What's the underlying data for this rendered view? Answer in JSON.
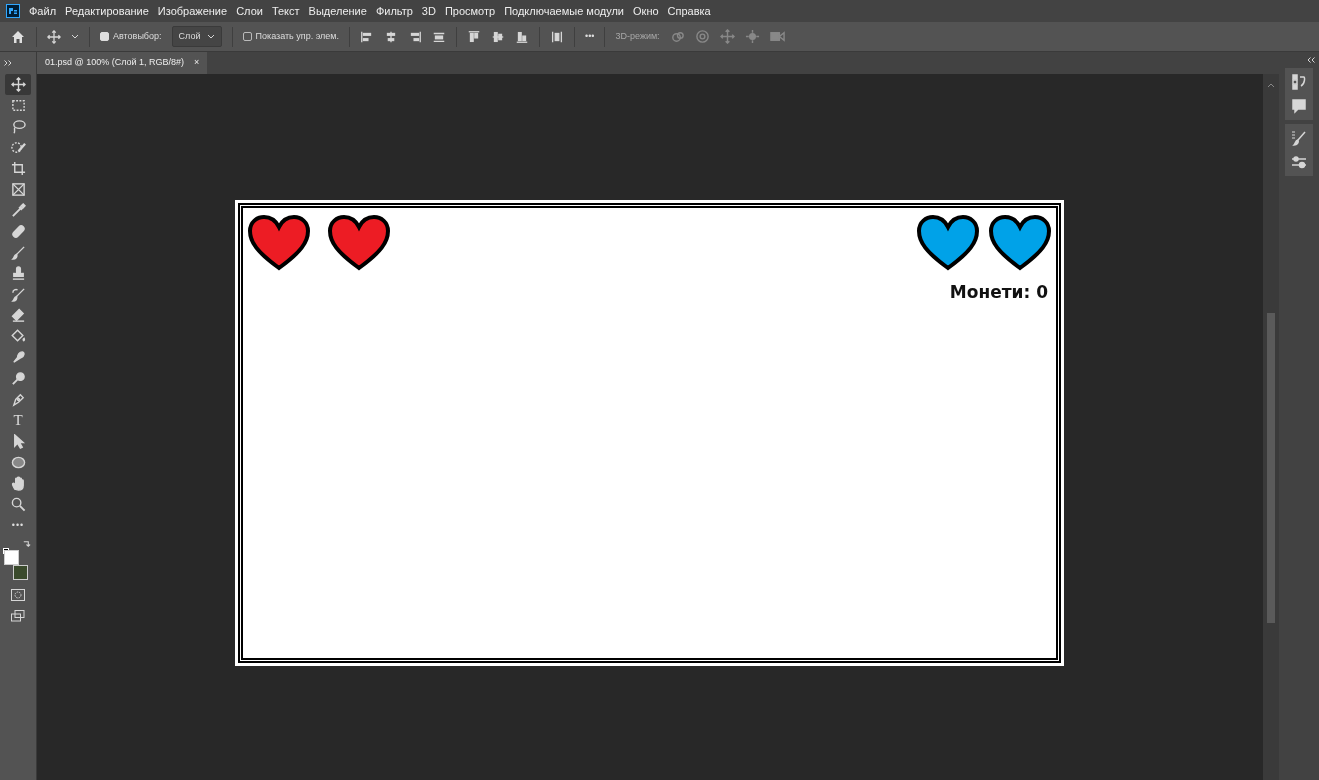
{
  "menu": {
    "items": [
      "Файл",
      "Редактирование",
      "Изображение",
      "Слои",
      "Текст",
      "Выделение",
      "Фильтр",
      "3D",
      "Просмотр",
      "Подключаемые модули",
      "Окно",
      "Справка"
    ]
  },
  "options_bar": {
    "autoselect": {
      "label": "Автовыбор:",
      "checked": true
    },
    "layer_dropdown": {
      "value": "Слой"
    },
    "show_transform": {
      "label": "Показать упр. элем.",
      "checked": false
    },
    "more_glyph": "•••",
    "mode_3d": {
      "label": "3D-режим:",
      "disabled": true
    }
  },
  "document_tab": {
    "title": "01.psd @ 100% (Слой 1, RGB/8#)",
    "close_glyph": "×",
    "selected": true
  },
  "tools": [
    {
      "kind": "move",
      "selected": true
    },
    {
      "kind": "marquee",
      "selected": false
    },
    {
      "kind": "lasso",
      "selected": false
    },
    {
      "kind": "quick-select",
      "selected": false
    },
    {
      "kind": "crop",
      "selected": false
    },
    {
      "kind": "frame",
      "selected": false
    },
    {
      "kind": "eyedropper",
      "selected": false
    },
    {
      "kind": "healing",
      "selected": false
    },
    {
      "kind": "brush",
      "selected": false
    },
    {
      "kind": "stamp",
      "selected": false
    },
    {
      "kind": "history-brush",
      "selected": false
    },
    {
      "kind": "eraser",
      "selected": false
    },
    {
      "kind": "bucket",
      "selected": false
    },
    {
      "kind": "smudge",
      "selected": false
    },
    {
      "kind": "dodge",
      "selected": false
    },
    {
      "kind": "pen",
      "selected": false
    },
    {
      "kind": "type",
      "glyph": "T",
      "selected": false
    },
    {
      "kind": "path-select",
      "selected": false
    },
    {
      "kind": "ellipse",
      "selected": false
    },
    {
      "kind": "hand",
      "selected": false
    },
    {
      "kind": "zoom",
      "selected": false
    },
    {
      "kind": "more",
      "glyph": "•••",
      "selected": false
    }
  ],
  "swatches": [
    {
      "kind": "foreground",
      "color": "#ffffff"
    },
    {
      "kind": "background",
      "color": "#3a4a2c"
    }
  ],
  "canvas": {
    "lives_left": [
      {
        "color": "#ed1c24"
      },
      {
        "color": "#ed1c24"
      }
    ],
    "lives_right": [
      {
        "color": "#00a2e8"
      },
      {
        "color": "#00a2e8"
      }
    ],
    "coins_text": "Монети: 0"
  }
}
